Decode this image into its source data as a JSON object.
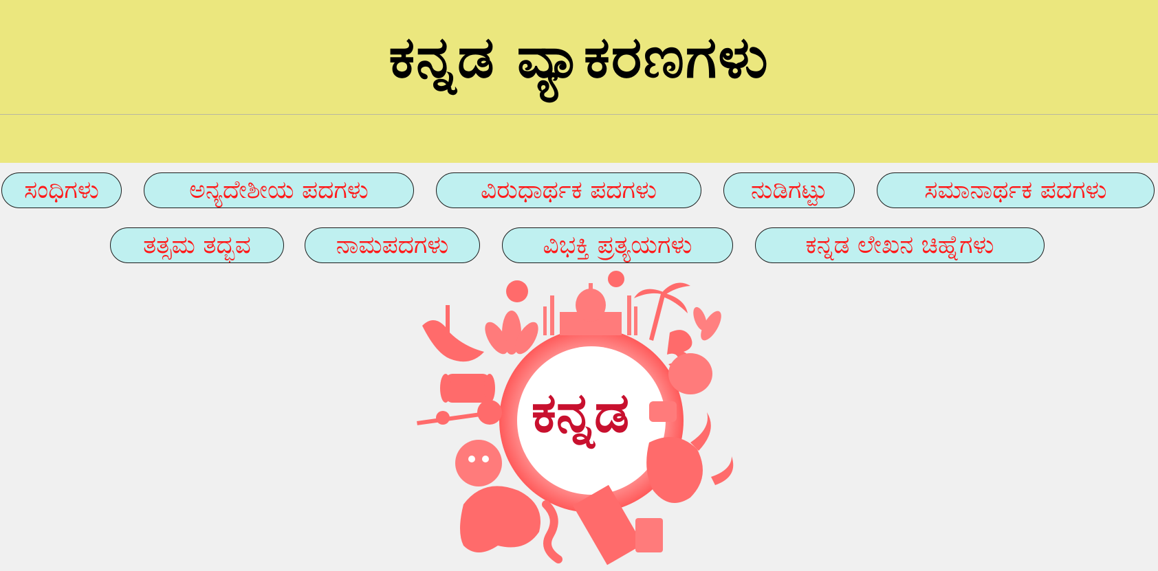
{
  "header": {
    "title": "ಕನ್ನಡ ವ್ಯಾಕರಣಗಳು",
    "background_color": "#ebe77e"
  },
  "nav": {
    "row1": [
      {
        "label": "ಸಂಧಿಗಳು"
      },
      {
        "label": "ಅನ್ಯದೇಶೀಯ ಪದಗಳು"
      },
      {
        "label": "ವಿರುಧಾರ್ಥಕ ಪದಗಳು"
      },
      {
        "label": "ನುಡಿಗಟ್ಟು"
      },
      {
        "label": "ಸಮಾನಾರ್ಥಕ ಪದಗಳು"
      }
    ],
    "row2": [
      {
        "label": "ತತ್ಸಮ ತದ್ಭವ"
      },
      {
        "label": "ನಾಮಪದಗಳು"
      },
      {
        "label": "ವಿಭಕ್ತಿ ಪ್ರತ್ಯಯಗಳು"
      },
      {
        "label": "ಕನ್ನಡ ಲೇಖನ ಚಿಹ್ನೆಗಳು"
      }
    ],
    "button_color": "#bff0f0",
    "text_color": "#ff1a1a"
  },
  "emblem": {
    "word": "ಕನ್ನಡ",
    "ring_color": "#ff6b6b",
    "text_color": "#c8102e",
    "icons": [
      "taj-mahal-icon",
      "palm-tree-icon",
      "lotus-icon",
      "dancer-icon",
      "drum-icon",
      "veena-icon",
      "mask-icon",
      "elephant-icon",
      "bull-icon",
      "temple-pillar-icon",
      "snake-icon",
      "flower-icon"
    ]
  }
}
